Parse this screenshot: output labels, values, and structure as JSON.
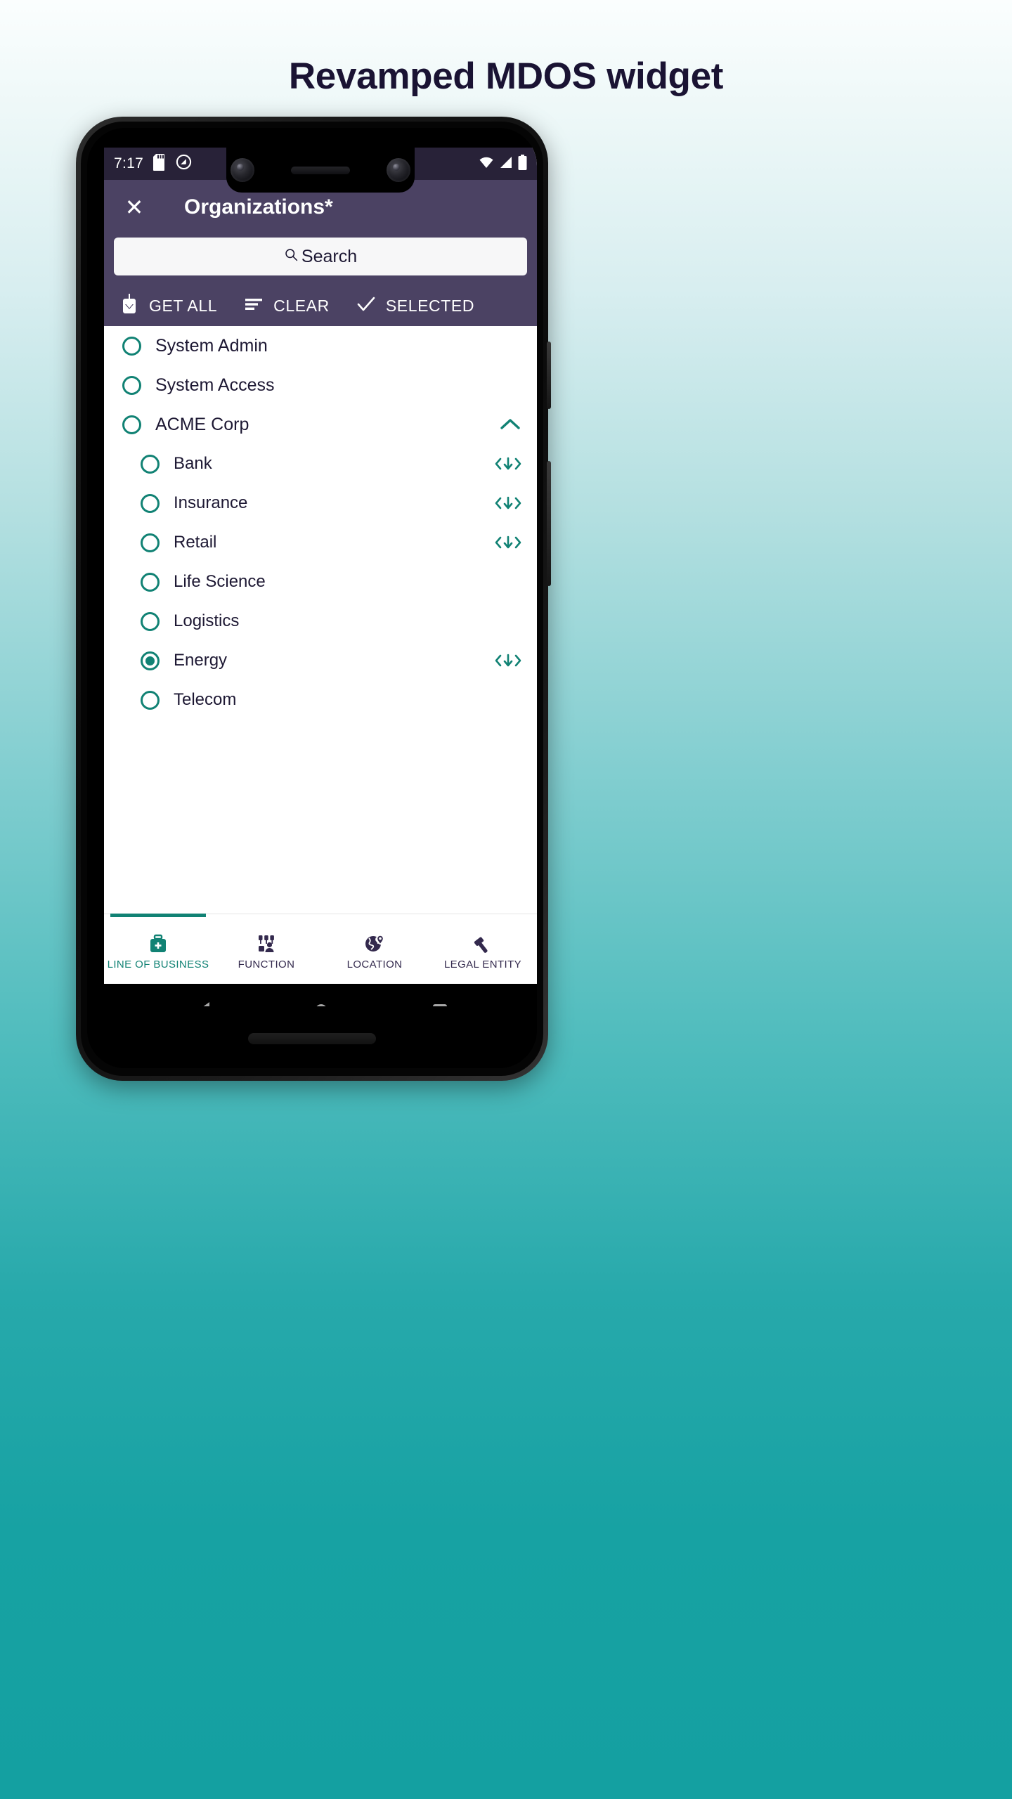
{
  "page": {
    "heading": "Revamped MDOS widget"
  },
  "status_bar": {
    "clock": "7:17",
    "icons": [
      "sd-card-icon",
      "do-not-disturb-icon"
    ],
    "right_icons": [
      "wifi-icon",
      "signal-icon",
      "battery-icon"
    ]
  },
  "app_bar": {
    "close_label": "✕",
    "title": "Organizations*"
  },
  "search": {
    "placeholder": "Search",
    "value": "",
    "icon": "search-icon"
  },
  "toolbar": {
    "actions": [
      {
        "icon": "download-icon",
        "label": "GET ALL"
      },
      {
        "icon": "sort-icon",
        "label": "CLEAR"
      },
      {
        "icon": "check-icon",
        "label": "SELECTED"
      }
    ]
  },
  "list": {
    "rows": [
      {
        "label": "System Admin",
        "level": 0,
        "selected": false,
        "trailing": "none"
      },
      {
        "label": "System Access",
        "level": 0,
        "selected": false,
        "trailing": "none"
      },
      {
        "label": "ACME Corp",
        "level": 0,
        "selected": false,
        "trailing": "chevron-up"
      },
      {
        "label": "Bank",
        "level": 1,
        "selected": false,
        "trailing": "expand-download"
      },
      {
        "label": "Insurance",
        "level": 1,
        "selected": false,
        "trailing": "expand-download"
      },
      {
        "label": "Retail",
        "level": 1,
        "selected": false,
        "trailing": "expand-download"
      },
      {
        "label": "Life Science",
        "level": 1,
        "selected": false,
        "trailing": "none"
      },
      {
        "label": "Logistics",
        "level": 1,
        "selected": false,
        "trailing": "none"
      },
      {
        "label": "Energy",
        "level": 1,
        "selected": true,
        "trailing": "expand-download"
      },
      {
        "label": "Telecom",
        "level": 1,
        "selected": false,
        "trailing": "none"
      }
    ]
  },
  "tab_bar": {
    "tabs": [
      {
        "label": "LINE OF BUSINESS",
        "icon": "briefcase-icon",
        "active": true
      },
      {
        "label": "FUNCTION",
        "icon": "org-chart-icon",
        "active": false
      },
      {
        "label": "LOCATION",
        "icon": "globe-pin-icon",
        "active": false
      },
      {
        "label": "LEGAL ENTITY",
        "icon": "gavel-icon",
        "active": false
      }
    ]
  },
  "nav_bar": {
    "buttons": [
      "back-icon",
      "home-icon",
      "recents-icon"
    ]
  },
  "colors": {
    "accent_teal": "#118274",
    "app_bar_purple": "#4b4263",
    "status_bar_purple": "#282238",
    "text_dark": "#1d1833",
    "background_teal": "#14a0a1"
  }
}
